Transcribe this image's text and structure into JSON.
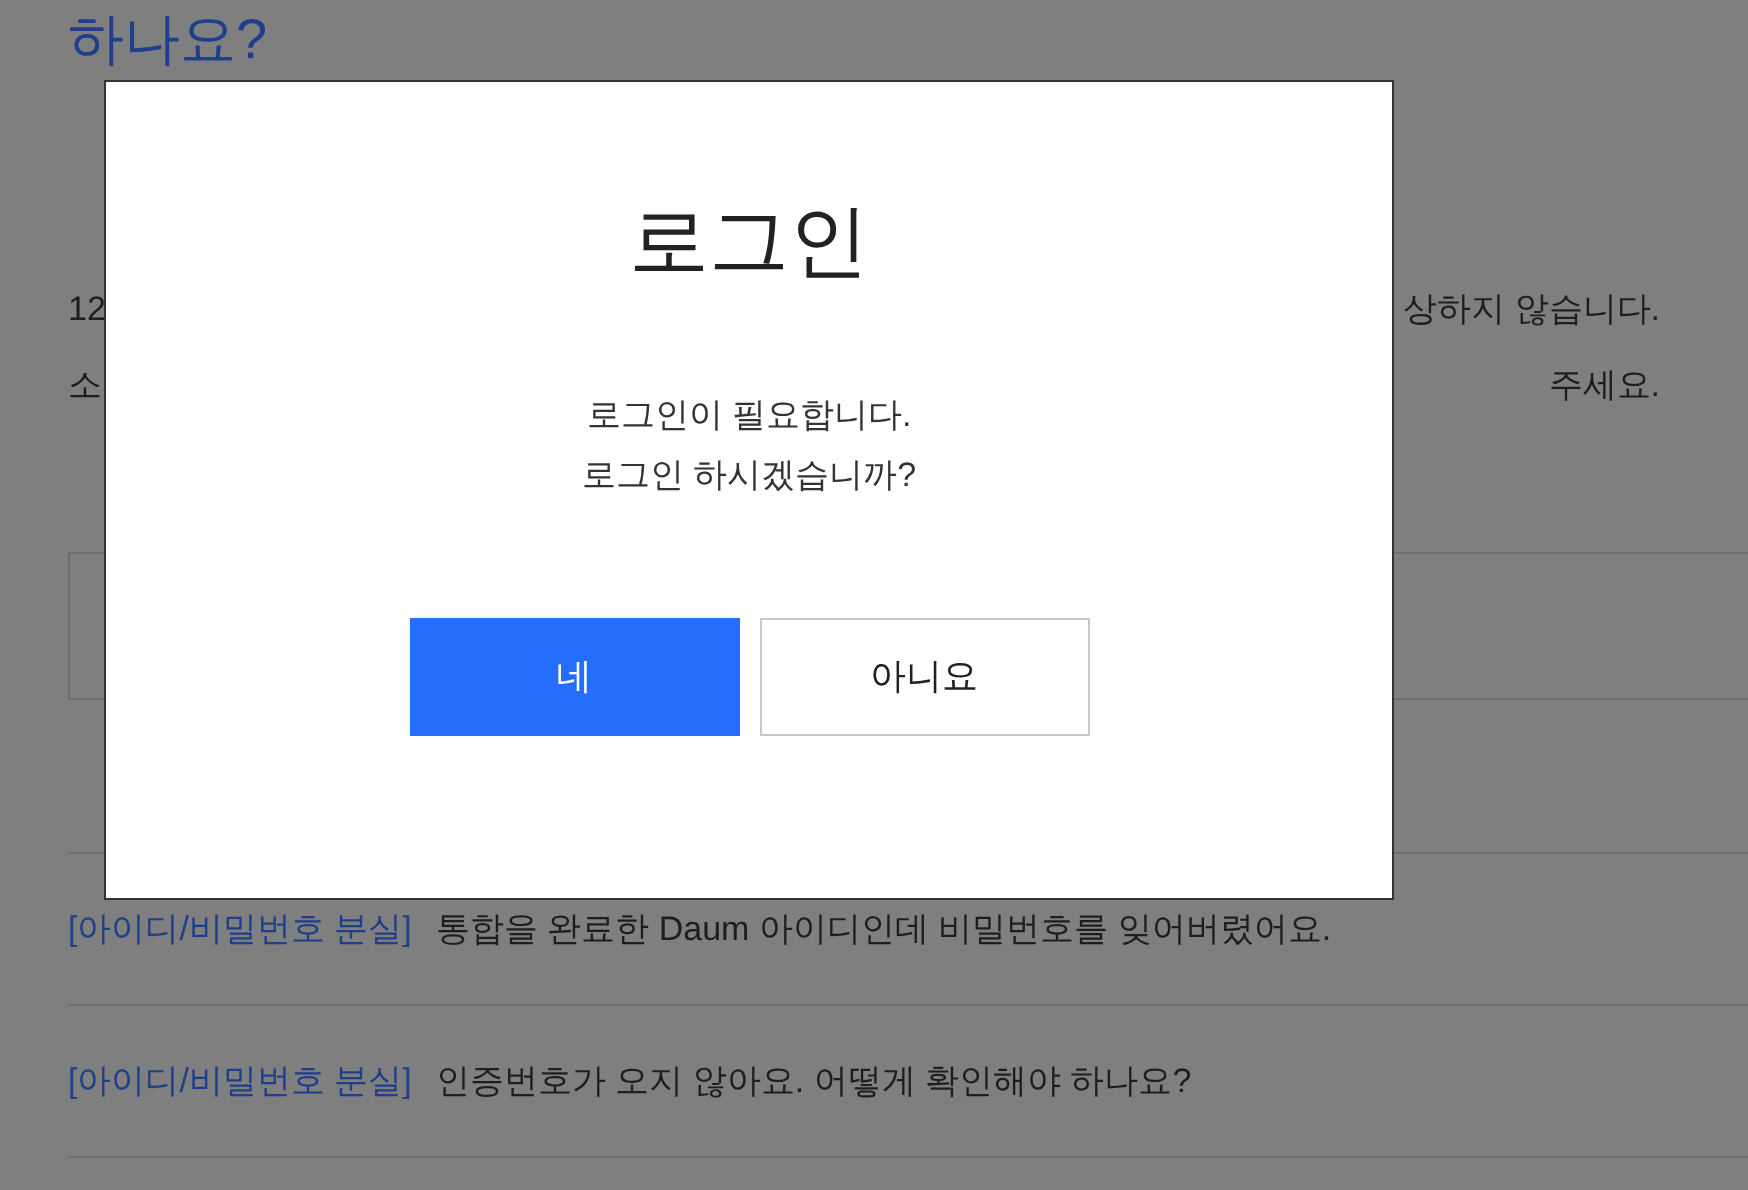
{
  "background": {
    "heading": "하나요?",
    "notice_lines": [
      {
        "start": "12",
        "end": "상하지 않습니다."
      },
      {
        "start": "소",
        "end": "주세요."
      }
    ],
    "faq_items": [
      {
        "category": "[아이디/비밀번호 분실]",
        "question": "통합을 완료한 Daum 아이디인데 비밀번호를 잊어버렸어요."
      },
      {
        "category": "[아이디/비밀번호 분실]",
        "question": "인증번호가 오지 않아요. 어떻게 확인해야 하나요?"
      }
    ]
  },
  "dialog": {
    "title": "로그인",
    "message": [
      "로그인이 필요합니다.",
      "로그인 하시겠습니까?"
    ],
    "buttons": [
      {
        "label": "네",
        "kind": "primary"
      },
      {
        "label": "아니요",
        "kind": "secondary"
      }
    ]
  }
}
